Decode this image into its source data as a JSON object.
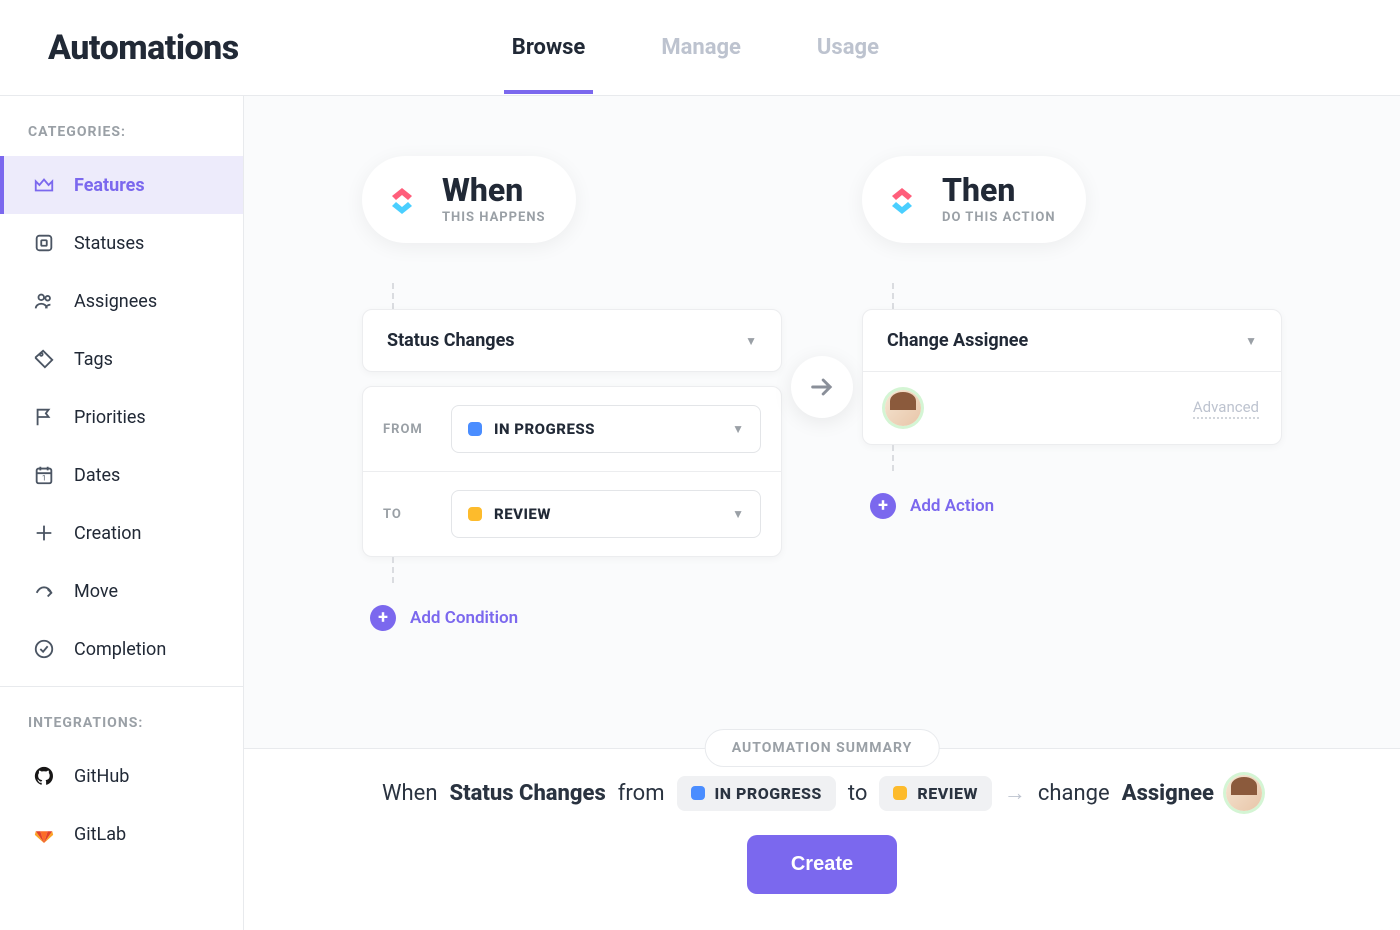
{
  "header": {
    "title": "Automations",
    "tabs": [
      {
        "label": "Browse",
        "active": true
      },
      {
        "label": "Manage",
        "active": false
      },
      {
        "label": "Usage",
        "active": false
      }
    ]
  },
  "sidebar": {
    "categories_label": "CATEGORIES:",
    "items": [
      {
        "icon": "crown-icon",
        "label": "Features",
        "active": true
      },
      {
        "icon": "status-icon",
        "label": "Statuses",
        "active": false
      },
      {
        "icon": "assignees-icon",
        "label": "Assignees",
        "active": false
      },
      {
        "icon": "tag-icon",
        "label": "Tags",
        "active": false
      },
      {
        "icon": "flag-icon",
        "label": "Priorities",
        "active": false
      },
      {
        "icon": "calendar-icon",
        "label": "Dates",
        "active": false
      },
      {
        "icon": "plus-icon",
        "label": "Creation",
        "active": false
      },
      {
        "icon": "move-icon",
        "label": "Move",
        "active": false
      },
      {
        "icon": "check-icon",
        "label": "Completion",
        "active": false
      }
    ],
    "integrations_label": "INTEGRATIONS:",
    "integrations": [
      {
        "icon": "github-icon",
        "label": "GitHub"
      },
      {
        "icon": "gitlab-icon",
        "label": "GitLab"
      }
    ]
  },
  "when": {
    "title": "When",
    "subtitle": "THIS HAPPENS",
    "trigger": "Status Changes",
    "from_label": "FROM",
    "from_status": {
      "name": "IN PROGRESS",
      "color": "#4A8DFF"
    },
    "to_label": "TO",
    "to_status": {
      "name": "REVIEW",
      "color": "#FDBB2C"
    },
    "add_condition": "Add Condition"
  },
  "then": {
    "title": "Then",
    "subtitle": "DO THIS ACTION",
    "action": "Change Assignee",
    "advanced": "Advanced",
    "add_action": "Add Action"
  },
  "summary": {
    "label": "AUTOMATION SUMMARY",
    "when_word": "When",
    "trigger": "Status Changes",
    "from_word": "from",
    "to_word": "to",
    "change_word": "change",
    "assignee_word": "Assignee",
    "create_label": "Create"
  }
}
